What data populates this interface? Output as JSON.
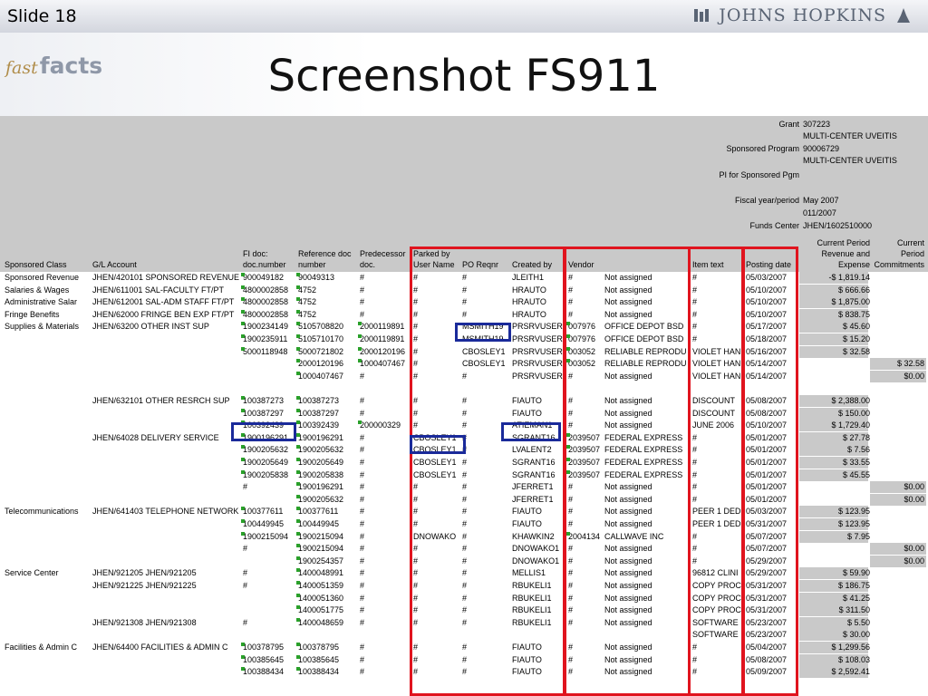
{
  "slide": {
    "label": "Slide 18"
  },
  "brand": {
    "name": "JOHNS HOPKINS"
  },
  "logo": {
    "fast": "fast",
    "facts": "facts"
  },
  "title": "Screenshot FS911",
  "grant_info": {
    "grant_label": "Grant",
    "grant_value": "307223",
    "grant_desc": "MULTI-CENTER UVEITIS",
    "sp_label": "Sponsored Program",
    "sp_value": "90006729",
    "sp_desc": "MULTI-CENTER UVEITIS",
    "pi_label": "PI for Sponsored Pgm",
    "fy_label": "Fiscal year/period",
    "fy_value": "May 2007",
    "fy_value2": "011/2007",
    "fc_label": "Funds Center",
    "fc_value": "JHEN/1602510000"
  },
  "columns": [
    "Sponsored Class",
    "G/L Account",
    "FI doc:\ndoc.number",
    "Reference doc\nnumber",
    "Predecessor\ndoc.",
    "Parked by\nUser Name",
    "PO Reqnr",
    "Created by",
    "Vendor",
    "Item text",
    "Posting date",
    "Current Period\nRevenue and\nExpense",
    "Current\nPeriod\nCommitments"
  ],
  "rows": [
    [
      "Sponsored Revenue",
      "JHEN/420101  SPONSORED REVENUE",
      "900049182",
      "90049313",
      "#",
      "#",
      "#",
      "JLEITH1",
      "#",
      "Not assigned",
      "#",
      "05/03/2007",
      "-$ 1,819.14",
      ""
    ],
    [
      "Salaries & Wages",
      "JHEN/611001  SAL-FACULTY FT/PT",
      "4800002858",
      "4752",
      "#",
      "#",
      "#",
      "HRAUTO",
      "#",
      "Not assigned",
      "#",
      "05/10/2007",
      "$ 666.66",
      ""
    ],
    [
      "Administrative Salar",
      "JHEN/612001  SAL-ADM STAFF FT/PT",
      "4800002858",
      "4752",
      "#",
      "#",
      "#",
      "HRAUTO",
      "#",
      "Not assigned",
      "#",
      "05/10/2007",
      "$ 1,875.00",
      ""
    ],
    [
      "Fringe Benefits",
      "JHEN/62000  FRINGE BEN EXP FT/PT",
      "4800002858",
      "4752",
      "#",
      "#",
      "#",
      "HRAUTO",
      "#",
      "Not assigned",
      "#",
      "05/10/2007",
      "$ 838.75",
      ""
    ],
    [
      "Supplies & Materials",
      "JHEN/63200  OTHER INST SUP",
      "1900234149",
      "5105708820",
      "2000119891",
      "#",
      "MSMITH19",
      "PRSRVUSER",
      "007976",
      "OFFICE DEPOT BSD",
      "#",
      "05/17/2007",
      "$ 45.60",
      ""
    ],
    [
      "",
      "",
      "1900235911",
      "5105710170",
      "2000119891",
      "#",
      "MSMITH19",
      "PRSRVUSER",
      "007976",
      "OFFICE DEPOT BSD",
      "#",
      "05/18/2007",
      "$ 15.20",
      ""
    ],
    [
      "",
      "",
      "5000118948",
      "5000721802",
      "2000120196",
      "#",
      "CBOSLEY1",
      "PRSRVUSER",
      "003052",
      "RELIABLE REPRODU",
      "VIOLET HAN",
      "05/16/2007",
      "$ 32.58",
      ""
    ],
    [
      "",
      "",
      "",
      "2000120196",
      "1000407467",
      "#",
      "CBOSLEY1",
      "PRSRVUSER",
      "003052",
      "RELIABLE REPRODU",
      "VIOLET HAN",
      "05/14/2007",
      "",
      "$ 32.58"
    ],
    [
      "",
      "",
      "",
      "1000407467",
      "#",
      "#",
      "#",
      "PRSRVUSER",
      "#",
      "Not assigned",
      "VIOLET HAN",
      "05/14/2007",
      "",
      "$0.00"
    ],
    [
      "",
      "",
      "",
      "",
      "",
      "",
      "",
      "",
      "",
      "",
      "",
      "",
      "",
      ""
    ],
    [
      "",
      "JHEN/632101  OTHER RESRCH SUP",
      "100387273",
      "100387273",
      "#",
      "#",
      "#",
      "FIAUTO",
      "#",
      "Not assigned",
      "DISCOUNT",
      "05/08/2007",
      "$ 2,388.00",
      ""
    ],
    [
      "",
      "",
      "100387297",
      "100387297",
      "#",
      "#",
      "#",
      "FIAUTO",
      "#",
      "Not assigned",
      "DISCOUNT",
      "05/08/2007",
      "$ 150.00",
      ""
    ],
    [
      "",
      "",
      "100392439",
      "100392439",
      "200000329",
      "#",
      "#",
      "ATIEMAN1",
      "#",
      "Not assigned",
      "JUNE 2006",
      "05/10/2007",
      "$ 1,729.40",
      ""
    ],
    [
      "",
      "JHEN/64028  DELIVERY SERVICE",
      "1900196291",
      "1900196291",
      "#",
      "CBOSLEY1",
      "#",
      "SGRANT16",
      "2039507",
      "FEDERAL EXPRESS",
      "#",
      "05/01/2007",
      "$ 27.78",
      ""
    ],
    [
      "",
      "",
      "1900205632",
      "1900205632",
      "#",
      "CBOSLEY1",
      "#",
      "LVALENT2",
      "2039507",
      "FEDERAL EXPRESS",
      "#",
      "05/01/2007",
      "$ 7.56",
      ""
    ],
    [
      "",
      "",
      "1900205649",
      "1900205649",
      "#",
      "CBOSLEY1",
      "#",
      "SGRANT16",
      "2039507",
      "FEDERAL EXPRESS",
      "#",
      "05/01/2007",
      "$ 33.55",
      ""
    ],
    [
      "",
      "",
      "1900205838",
      "1900205838",
      "#",
      "CBOSLEY1",
      "#",
      "SGRANT16",
      "2039507",
      "FEDERAL EXPRESS",
      "#",
      "05/01/2007",
      "$ 45.55",
      ""
    ],
    [
      "",
      "",
      "#",
      "1900196291",
      "#",
      "#",
      "#",
      "JFERRET1",
      "#",
      "Not assigned",
      "#",
      "05/01/2007",
      "",
      "$0.00"
    ],
    [
      "",
      "",
      "",
      "1900205632",
      "#",
      "#",
      "#",
      "JFERRET1",
      "#",
      "Not assigned",
      "#",
      "05/01/2007",
      "",
      "$0.00"
    ],
    [
      "Telecommunications",
      "JHEN/641403  TELEPHONE NETWORK",
      "100377611",
      "100377611",
      "#",
      "#",
      "#",
      "FIAUTO",
      "#",
      "Not assigned",
      "PEER 1 DED",
      "05/03/2007",
      "$ 123.95",
      ""
    ],
    [
      "",
      "",
      "100449945",
      "100449945",
      "#",
      "#",
      "#",
      "FIAUTO",
      "#",
      "Not assigned",
      "PEER 1 DED",
      "05/31/2007",
      "$ 123.95",
      ""
    ],
    [
      "",
      "",
      "1900215094",
      "1900215094",
      "#",
      "DNOWAKO",
      "#",
      "KHAWKIN2",
      "2004134",
      "CALLWAVE INC",
      "#",
      "05/07/2007",
      "$ 7.95",
      ""
    ],
    [
      "",
      "",
      "#",
      "1900215094",
      "#",
      "#",
      "#",
      "DNOWAKO1",
      "#",
      "Not assigned",
      "#",
      "05/07/2007",
      "",
      "$0.00"
    ],
    [
      "",
      "",
      "",
      "1900254357",
      "#",
      "#",
      "#",
      "DNOWAKO1",
      "#",
      "Not assigned",
      "#",
      "05/29/2007",
      "",
      "$0.00"
    ],
    [
      "Service Center",
      "JHEN/921205  JHEN/921205",
      "#",
      "1400048991",
      "#",
      "#",
      "#",
      "MELLIS1",
      "#",
      "Not assigned",
      "96812 CLINI",
      "05/29/2007",
      "$ 59.90",
      ""
    ],
    [
      "",
      "JHEN/921225  JHEN/921225",
      "#",
      "1400051359",
      "#",
      "#",
      "#",
      "RBUKELI1",
      "#",
      "Not assigned",
      "COPY PROC",
      "05/31/2007",
      "$ 186.75",
      ""
    ],
    [
      "",
      "",
      "",
      "1400051360",
      "#",
      "#",
      "#",
      "RBUKELI1",
      "#",
      "Not assigned",
      "COPY PROC",
      "05/31/2007",
      "$ 41.25",
      ""
    ],
    [
      "",
      "",
      "",
      "1400051775",
      "#",
      "#",
      "#",
      "RBUKELI1",
      "#",
      "Not assigned",
      "COPY PROC",
      "05/31/2007",
      "$ 311.50",
      ""
    ],
    [
      "",
      "JHEN/921308  JHEN/921308",
      "#",
      "1400048659",
      "#",
      "#",
      "#",
      "RBUKELI1",
      "#",
      "Not assigned",
      "SOFTWARE",
      "05/23/2007",
      "$ 5.50",
      ""
    ],
    [
      "",
      "",
      "",
      "",
      "",
      "",
      "",
      "",
      "",
      "",
      "SOFTWARE",
      "05/23/2007",
      "$ 30.00",
      ""
    ],
    [
      "Facilities & Admin C",
      "JHEN/64400  FACILITIES & ADMIN C",
      "100378795",
      "100378795",
      "#",
      "#",
      "#",
      "FIAUTO",
      "#",
      "Not assigned",
      "#",
      "05/04/2007",
      "$ 1,299.56",
      ""
    ],
    [
      "",
      "",
      "100385645",
      "100385645",
      "#",
      "#",
      "#",
      "FIAUTO",
      "#",
      "Not assigned",
      "#",
      "05/08/2007",
      "$ 108.03",
      ""
    ],
    [
      "",
      "",
      "100388434",
      "100388434",
      "#",
      "#",
      "#",
      "FIAUTO",
      "#",
      "Not assigned",
      "#",
      "05/09/2007",
      "$ 2,592.41",
      ""
    ]
  ],
  "colors": {
    "red_box": "#e0141e",
    "blue_box": "#1a2a9a",
    "grey_band": "#c9c9c9"
  }
}
